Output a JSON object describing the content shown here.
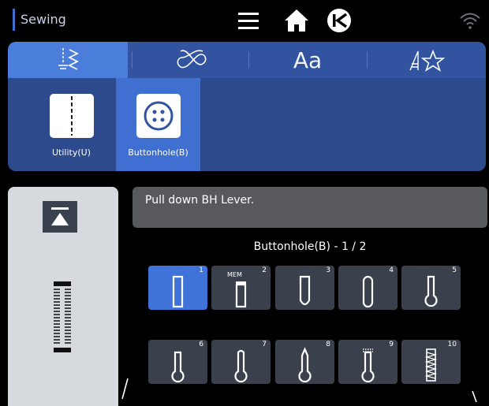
{
  "header": {
    "mode": "Sewing"
  },
  "types": [
    {
      "label": "Utility(U)"
    },
    {
      "label": "Buttonhole(B)"
    }
  ],
  "tabs": {
    "text_tab": "Aa"
  },
  "message": "Pull down BH Lever.",
  "page_title": "Buttonhole(B) - 1 / 2",
  "stitches": [
    {
      "num": "1"
    },
    {
      "num": "2",
      "tag": "MEM"
    },
    {
      "num": "3"
    },
    {
      "num": "4"
    },
    {
      "num": "5"
    },
    {
      "num": "6"
    },
    {
      "num": "7"
    },
    {
      "num": "8"
    },
    {
      "num": "9"
    },
    {
      "num": "10"
    }
  ],
  "colors": {
    "accent": "#3f73d8",
    "tab_bar": "#3254a0",
    "type_row": "#2d4a8c",
    "cell": "#3b414c"
  }
}
